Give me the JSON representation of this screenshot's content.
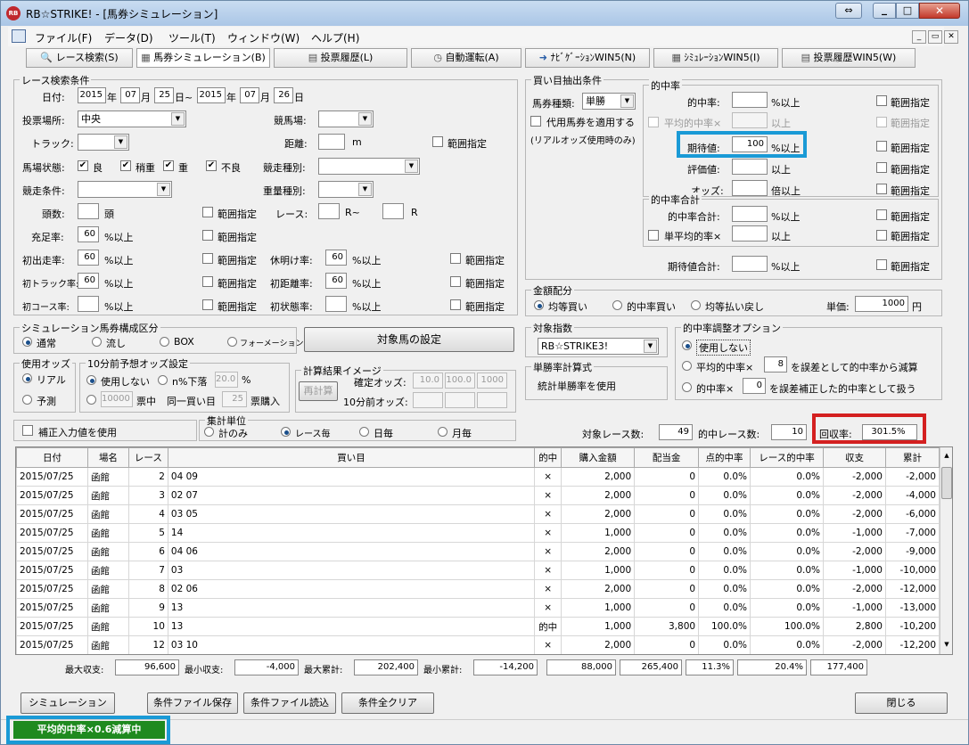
{
  "window": {
    "title": "RB☆STRIKE! - [馬券シミュレーション]",
    "app_icon": "RB"
  },
  "menu": [
    "ファイル(F)",
    "データ(D)",
    "ツール(T)",
    "ウィンドウ(W)",
    "ヘルプ(H)"
  ],
  "tabs": [
    "レース検索(S)",
    "馬券シミュレーション(B)",
    "投票履歴(L)",
    "自動運転(A)",
    "ﾅﾋﾞｹﾞｰｼｮﾝWIN5(N)",
    "ｼﾐｭﾚｰｼｮﾝWIN5(I)",
    "投票履歴WIN5(W)"
  ],
  "race_search": {
    "title": "レース検索条件",
    "date_label": "日付:",
    "date_from": {
      "year": "2015",
      "year_unit": "年",
      "month": "07",
      "month_unit": "月",
      "day": "25",
      "day_unit": "日~"
    },
    "date_to": {
      "year": "2015",
      "year_unit": "年",
      "month": "07",
      "month_unit": "月",
      "day": "26",
      "day_unit": "日"
    },
    "venue_label": "投票場所:",
    "venue_value": "中央",
    "track_name_label": "競馬場:",
    "track_label": "トラック:",
    "distance_label": "距離:",
    "distance_unit": "m",
    "range_label": "範囲指定",
    "condition_label": "馬場状態:",
    "conditions": [
      "良",
      "稍重",
      "重",
      "不良"
    ],
    "race_type_label": "競走種別:",
    "race_cond_label": "競走条件:",
    "weight_label": "重量種別:",
    "heads_label": "頭数:",
    "heads_unit": "頭",
    "race_label": "レース:",
    "race_mid": "R~",
    "race_end": "R",
    "fill_label": "充足率:",
    "fill_value": "60",
    "pct_above": "%以上",
    "first_run_label": "初出走率:",
    "first_run_value": "60",
    "rest_label": "休明け率:",
    "rest_value": "60",
    "first_track_label": "初トラック率:",
    "first_track_value": "60",
    "first_dist_label": "初距離率:",
    "first_dist_value": "60",
    "first_course_label": "初コース率:",
    "first_state_label": "初状態率:"
  },
  "sim_type": {
    "title": "シミュレーション馬券構成区分",
    "options": [
      "通常",
      "流し",
      "BOX",
      "フォーメーション"
    ],
    "target_button": "対象馬の設定"
  },
  "odds_used": {
    "title": "使用オッズ",
    "options": [
      "リアル",
      "予測"
    ]
  },
  "odds10": {
    "title": "10分前予想オッズ設定",
    "opt1": "使用しない",
    "opt2": "n%下落",
    "pct_value": "20.0",
    "pct_unit": "%",
    "ticket_value": "10000",
    "ticket_label": "票中",
    "same_label": "同一買い目",
    "count_value": "25",
    "count_label": "票購入"
  },
  "calc_image": {
    "title": "計算結果イメージ",
    "recalc_button": "再計算",
    "fixed_label": "確定オッズ:",
    "fixed_values": [
      "10.0",
      "100.0",
      "1000"
    ],
    "pre10_label": "10分前オッズ:"
  },
  "correction": {
    "label": "補正入力値を使用"
  },
  "aggregate": {
    "title": "集計単位",
    "options": [
      "計のみ",
      "レース毎",
      "日毎",
      "月毎"
    ]
  },
  "buy_extract": {
    "title": "買い目抽出条件",
    "ticket_kind_label": "馬券種類:",
    "ticket_kind_value": "単勝",
    "proxy_label": "代用馬券を適用する",
    "proxy_note": "(リアルオッズ使用時のみ)"
  },
  "hit_rate": {
    "title": "的中率",
    "hit_label": "的中率:",
    "avg_hit_label": "平均的中率×",
    "expect_label": "期待値:",
    "expect_value": "100",
    "eval_label": "評価値:",
    "odds_label": "オッズ:",
    "pct_above": "%以上",
    "above": "以上",
    "times_above": "倍以上",
    "range_label": "範囲指定"
  },
  "hit_sum": {
    "title": "的中率合計",
    "hit_sum_label": "的中率合計:",
    "single_avg_label": "単平均的率×",
    "expect_sum_label": "期待値合計:"
  },
  "money": {
    "title": "金額配分",
    "options": [
      "均等買い",
      "的中率買い",
      "均等払い戻し"
    ],
    "unit_label": "単価:",
    "unit_value": "1000",
    "unit_yen": "円"
  },
  "index": {
    "title": "対象指数",
    "value": "RB☆STRIKE3!"
  },
  "single_rate": {
    "title": "単勝率計算式",
    "value": "統計単勝率を使用"
  },
  "hit_adjust": {
    "title": "的中率調整オプション",
    "opt1": "使用しない",
    "opt2_pre": "平均的中率×",
    "opt2_value": "8",
    "opt2_post": "を誤差として的中率から減算",
    "opt3_pre": "的中率×",
    "opt3_value": "0",
    "opt3_post": "を誤差補正した的中率として扱う"
  },
  "summary": {
    "races_label": "対象レース数:",
    "races_value": "49",
    "hits_label": "的中レース数:",
    "hits_value": "10",
    "recovery_label": "回収率:",
    "recovery_value": "301.5%"
  },
  "table": {
    "headers": [
      "日付",
      "場名",
      "レース",
      "買い目",
      "的中",
      "購入金額",
      "配当金",
      "点的中率",
      "レース的中率",
      "収支",
      "累計"
    ],
    "rows": [
      [
        "2015/07/25",
        "函館",
        "2",
        "04 09",
        "×",
        "2,000",
        "0",
        "0.0%",
        "0.0%",
        "-2,000",
        "-2,000"
      ],
      [
        "2015/07/25",
        "函館",
        "3",
        "02 07",
        "×",
        "2,000",
        "0",
        "0.0%",
        "0.0%",
        "-2,000",
        "-4,000"
      ],
      [
        "2015/07/25",
        "函館",
        "4",
        "03 05",
        "×",
        "2,000",
        "0",
        "0.0%",
        "0.0%",
        "-2,000",
        "-6,000"
      ],
      [
        "2015/07/25",
        "函館",
        "5",
        "14",
        "×",
        "1,000",
        "0",
        "0.0%",
        "0.0%",
        "-1,000",
        "-7,000"
      ],
      [
        "2015/07/25",
        "函館",
        "6",
        "04 06",
        "×",
        "2,000",
        "0",
        "0.0%",
        "0.0%",
        "-2,000",
        "-9,000"
      ],
      [
        "2015/07/25",
        "函館",
        "7",
        "03",
        "×",
        "1,000",
        "0",
        "0.0%",
        "0.0%",
        "-1,000",
        "-10,000"
      ],
      [
        "2015/07/25",
        "函館",
        "8",
        "02 06",
        "×",
        "2,000",
        "0",
        "0.0%",
        "0.0%",
        "-2,000",
        "-12,000"
      ],
      [
        "2015/07/25",
        "函館",
        "9",
        "13",
        "×",
        "1,000",
        "0",
        "0.0%",
        "0.0%",
        "-1,000",
        "-13,000"
      ],
      [
        "2015/07/25",
        "函館",
        "10",
        "13",
        "的中",
        "1,000",
        "3,800",
        "100.0%",
        "100.0%",
        "2,800",
        "-10,200"
      ],
      [
        "2015/07/25",
        "函館",
        "12",
        "03 10",
        "×",
        "2,000",
        "0",
        "0.0%",
        "0.0%",
        "-2,000",
        "-12,200"
      ]
    ]
  },
  "totals": {
    "max_income_label": "最大収支:",
    "max_income": "96,600",
    "min_income_label": "最小収支:",
    "min_income": "-4,000",
    "max_cum_label": "最大累計:",
    "max_cum": "202,400",
    "min_cum_label": "最小累計:",
    "min_cum": "-14,200",
    "buy_total": "88,000",
    "pay_total": "265,400",
    "point_rate": "11.3%",
    "race_rate": "20.4%",
    "balance": "177,400"
  },
  "buttons": {
    "simulate": "シミュレーション",
    "save": "条件ファイル保存",
    "load": "条件ファイル読込",
    "clear": "条件全クリア",
    "close": "閉じる"
  },
  "status": {
    "text": "平均的中率×0.6減算中"
  },
  "colors": {
    "highlight_blue": "#1a9ad6",
    "highlight_red": "#d42020",
    "status_green": "#1f8a1f"
  }
}
